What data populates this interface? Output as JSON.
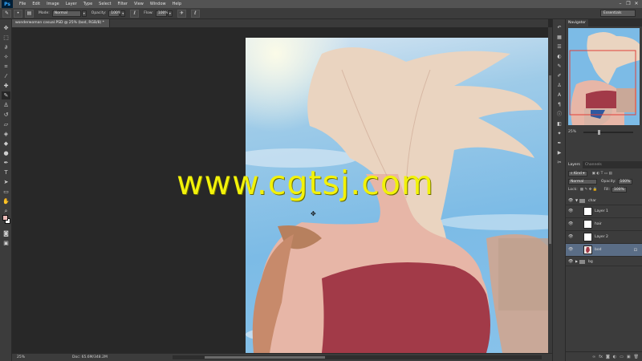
{
  "app": {
    "logo": "Ps"
  },
  "menu": [
    "File",
    "Edit",
    "Image",
    "Layer",
    "Type",
    "Select",
    "Filter",
    "View",
    "Window",
    "Help"
  ],
  "options_bar": {
    "mode_label": "Mode:",
    "mode_value": "Normal",
    "opacity_label": "Opacity:",
    "opacity_value": "100%",
    "flow_label": "Flow:",
    "flow_value": "100%",
    "workspace": "Essentials"
  },
  "document": {
    "tab_title": "wonderwoman casual.PSD @ 25% (bod, RGB/8) *",
    "zoom": "25%",
    "doc_size": "Doc: 65.6M/348.2M"
  },
  "navigator": {
    "tabs": [
      "Navigator"
    ],
    "zoom": "25%",
    "zoom_fraction": 0.3
  },
  "layers_panel": {
    "tabs": [
      "Layers",
      "Channels"
    ],
    "filter_kind": "Kind",
    "blend_mode": "Normal",
    "opacity_label": "Opacity:",
    "opacity": "100%",
    "lock_label": "Lock:",
    "fill_label": "Fill:",
    "fill": "100%",
    "group_char": "char",
    "layers": [
      "Layer 1",
      "hair",
      "Layer 2",
      "bod"
    ],
    "selected_layer": "bod",
    "group_bg": "bg"
  },
  "watermark": "www.cgtsj.com",
  "colors": {
    "foreground": "#e9b9b6",
    "background": "#ffffff",
    "selection": "#5a6d86",
    "sky": "#7cbbe6",
    "skin": "#e8d3c3",
    "top": "#a23a48"
  }
}
